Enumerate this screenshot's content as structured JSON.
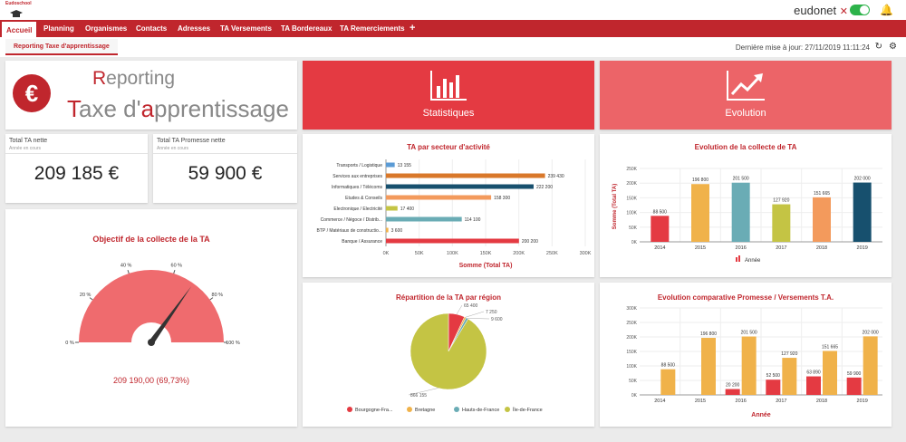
{
  "app": {
    "logo_text": "Eudoschool",
    "brand": "eudonet",
    "brand_mark": "✕"
  },
  "nav": {
    "items": [
      "Accueil",
      "Planning",
      "Organismes",
      "Contacts",
      "Adresses",
      "TA Versements",
      "TA Bordereaux",
      "TA Remerciements"
    ],
    "plus": "+"
  },
  "subbar": {
    "tab": "Reporting Taxe d'apprentissage",
    "last_update": "Dernière mise à jour: 27/11/2019 11:11:24"
  },
  "header": {
    "line1_first": "R",
    "line1_rest": "eporting",
    "line2_a": "T",
    "line2_b": "axe d'",
    "line2_c": "a",
    "line2_d": "pprentissage",
    "currency": "€"
  },
  "tiles": {
    "stats": "Statistiques",
    "evolution": "Evolution"
  },
  "kpi": [
    {
      "label": "Total TA nette",
      "sub": "Année en cours",
      "value": "209 185 €"
    },
    {
      "label": "Total TA Promesse nette",
      "sub": "Année en cours",
      "value": "59 900 €"
    }
  ],
  "gauge": {
    "title": "Objectif de la collecte de la TA",
    "value_text": "209 190,00 (69,73%)",
    "percent": 69.73,
    "ticks": [
      "0 %",
      "20 %",
      "40 %",
      "60 %",
      "80 %",
      "100 %"
    ]
  },
  "chart_data": [
    {
      "type": "bar",
      "orientation": "horizontal",
      "title": "TA par secteur d'activité",
      "xlabel": "Somme (Total TA)",
      "xlim": [
        0,
        300000
      ],
      "xticks": [
        "0K",
        "50K",
        "100K",
        "150K",
        "200K",
        "250K",
        "300K"
      ],
      "categories": [
        "Transports / Logistique",
        "Services aux entreprises",
        "Informatiques / Télécoms",
        "Etudes & Conseils",
        "Electronique / Electricité",
        "Commerce / Négoce / Distrib...",
        "BTP / Matériaux de constructio...",
        "Banque / Assurance"
      ],
      "values": [
        13155,
        239430,
        222200,
        158300,
        17400,
        114100,
        3600,
        200200
      ],
      "labels": [
        "13 155",
        "239 430",
        "222 200",
        "158 300",
        "17 400",
        "114 100",
        "3 600",
        "200 200"
      ],
      "colors": [
        "#5b9bd5",
        "#d9782a",
        "#17506e",
        "#f39a5c",
        "#c4c444",
        "#6aacb5",
        "#f0b24a",
        "#e43a42"
      ]
    },
    {
      "type": "bar",
      "title": "Evolution de la collecte de TA",
      "ylabel": "Somme (Total TA)",
      "ylim": [
        0,
        250000
      ],
      "yticks": [
        "0K",
        "50K",
        "100K",
        "150K",
        "200K",
        "250K"
      ],
      "categories": [
        "2014",
        "2015",
        "2016",
        "2017",
        "2018",
        "2019"
      ],
      "values": [
        88500,
        196800,
        201500,
        127920,
        151665,
        202000
      ],
      "labels": [
        "88 500",
        "196 800",
        "201 500",
        "127 920",
        "151 665",
        "202 000"
      ],
      "colors": [
        "#e43a42",
        "#f0b24a",
        "#6aacb5",
        "#c4c444",
        "#f39a5c",
        "#17506e"
      ],
      "legend": "Année"
    },
    {
      "type": "pie",
      "title": "Répartition de la TA par région",
      "labels": [
        "Bourgogne-Fra...",
        "Bretagne",
        "Hauts-de-France",
        "Île-de-France"
      ],
      "values": [
        65400,
        7250,
        9600,
        866155
      ],
      "value_labels": [
        "65 400",
        "7 250",
        "9 600",
        "866 155"
      ],
      "colors": [
        "#e43a42",
        "#f0b24a",
        "#6aacb5",
        "#c4c444"
      ]
    },
    {
      "type": "bar",
      "title": "Evolution comparative Promesse / Versements T.A.",
      "xlabel": "Année",
      "ylim": [
        0,
        300000
      ],
      "yticks": [
        "0K",
        "50K",
        "100K",
        "150K",
        "200K",
        "250K",
        "300K"
      ],
      "categories": [
        "2014",
        "2015",
        "2016",
        "2017",
        "2018",
        "2019"
      ],
      "series": [
        {
          "values": [
            0,
            0,
            20200,
            52500,
            63890,
            59900
          ],
          "labels": [
            "",
            "",
            "20 200",
            "52 500",
            "63 890",
            "59 900"
          ],
          "color": "#e43a42"
        },
        {
          "values": [
            88500,
            196800,
            201500,
            127920,
            151665,
            202000
          ],
          "labels": [
            "88 500",
            "196 800",
            "201 500",
            "127 920",
            "151 665",
            "202 000"
          ],
          "color": "#f0b24a"
        }
      ]
    }
  ]
}
